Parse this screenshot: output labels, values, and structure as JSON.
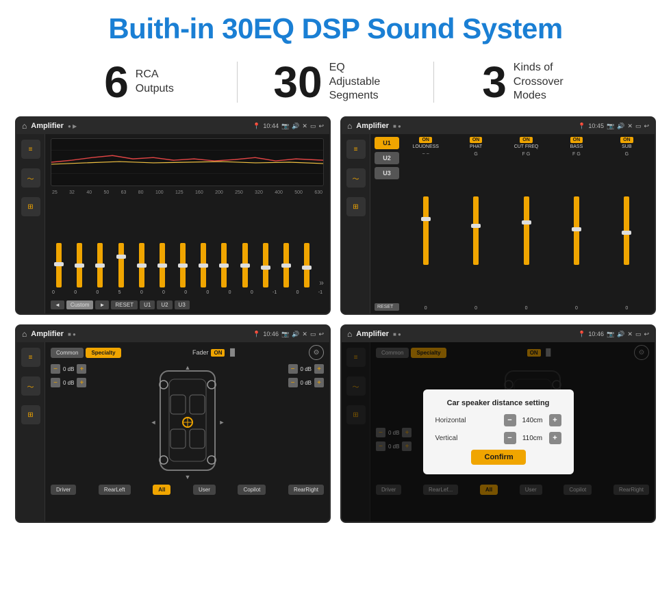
{
  "page": {
    "title": "Buith-in 30EQ DSP Sound System"
  },
  "stats": [
    {
      "number": "6",
      "text_line1": "RCA",
      "text_line2": "Outputs"
    },
    {
      "number": "30",
      "text_line1": "EQ Adjustable",
      "text_line2": "Segments"
    },
    {
      "number": "3",
      "text_line1": "Kinds of",
      "text_line2": "Crossover Modes"
    }
  ],
  "screens": [
    {
      "id": "screen-eq",
      "header_title": "Amplifier",
      "header_time": "10:44",
      "type": "eq",
      "freq_labels": [
        "25",
        "32",
        "40",
        "50",
        "63",
        "80",
        "100",
        "125",
        "160",
        "200",
        "250",
        "320",
        "400",
        "500",
        "630"
      ],
      "slider_values": [
        "0",
        "0",
        "0",
        "5",
        "0",
        "0",
        "0",
        "0",
        "0",
        "0",
        "-1",
        "0",
        "-1"
      ],
      "bottom_buttons": [
        "◄",
        "Custom",
        "►",
        "RESET",
        "U1",
        "U2",
        "U3"
      ]
    },
    {
      "id": "screen-crossover",
      "header_title": "Amplifier",
      "header_time": "10:45",
      "type": "crossover",
      "u_buttons": [
        "U1",
        "U2",
        "U3"
      ],
      "channels": [
        "LOUDNESS",
        "PHAT",
        "CUT FREQ",
        "BASS",
        "SUB"
      ],
      "reset_label": "RESET"
    },
    {
      "id": "screen-fader",
      "header_title": "Amplifier",
      "header_time": "10:46",
      "type": "fader",
      "tabs": [
        "Common",
        "Specialty"
      ],
      "active_tab": "Specialty",
      "fader_label": "Fader",
      "fader_on": "ON",
      "db_values": [
        "0 dB",
        "0 dB",
        "0 dB",
        "0 dB"
      ],
      "bottom_buttons": [
        "Driver",
        "RearLeft",
        "All",
        "User",
        "Copilot",
        "RearRight"
      ]
    },
    {
      "id": "screen-distance",
      "header_title": "Amplifier",
      "header_time": "10:46",
      "type": "distance",
      "tabs": [
        "Common",
        "Specialty"
      ],
      "active_tab": "Specialty",
      "fader_on": "ON",
      "dialog": {
        "title": "Car speaker distance setting",
        "horizontal_label": "Horizontal",
        "horizontal_value": "140cm",
        "vertical_label": "Vertical",
        "vertical_value": "110cm",
        "confirm_label": "Confirm"
      },
      "db_values": [
        "0 dB",
        "0 dB"
      ],
      "bottom_buttons": [
        "Driver",
        "RearLeft",
        "All",
        "User",
        "Copilot",
        "RearRight"
      ]
    }
  ]
}
